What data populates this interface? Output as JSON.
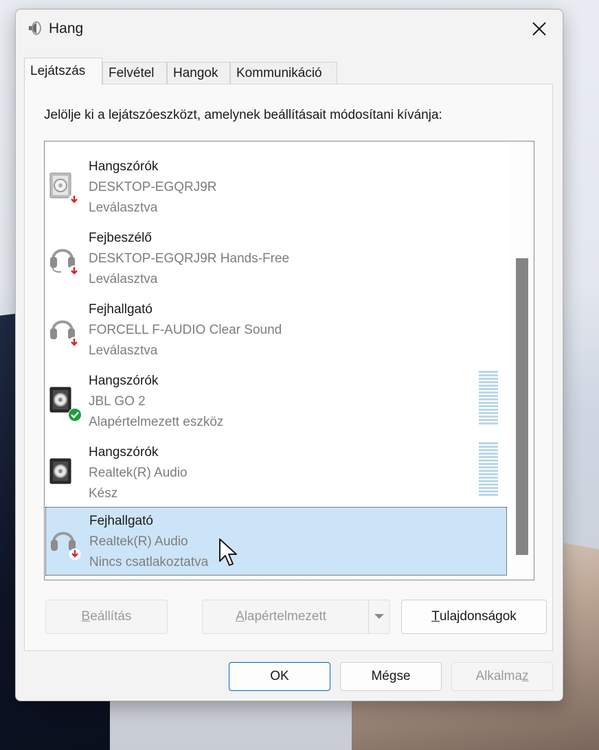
{
  "window": {
    "title": "Hang",
    "icon": "speaker-icon"
  },
  "tabs": [
    {
      "label": "Lejátszás",
      "active": true
    },
    {
      "label": "Felvétel",
      "active": false
    },
    {
      "label": "Hangok",
      "active": false
    },
    {
      "label": "Kommunikáció",
      "active": false
    }
  ],
  "instruction": "Jelölje ki a lejátszóeszközt, amelynek beállításait módosítani kívánja:",
  "devices": [
    {
      "name": "Hangszórók",
      "detail": "DESKTOP-EGQRJ9R",
      "status": "Leválasztva",
      "icon": "speaker-icon",
      "badge": "disconnected-arrow-icon"
    },
    {
      "name": "Fejbeszélő",
      "detail": "DESKTOP-EGQRJ9R Hands-Free",
      "status": "Leválasztva",
      "icon": "headset-icon",
      "badge": "disconnected-arrow-icon"
    },
    {
      "name": "Fejhallgató",
      "detail": "FORCELL F-AUDIO Clear Sound",
      "status": "Leválasztva",
      "icon": "headphones-icon",
      "badge": "disconnected-arrow-icon"
    },
    {
      "name": "Hangszórók",
      "detail": "JBL GO 2",
      "status": "Alapértelmezett eszköz",
      "icon": "speaker-icon",
      "badge": "default-check-icon"
    },
    {
      "name": "Hangszórók",
      "detail": "Realtek(R) Audio",
      "status": "Kész",
      "icon": "speaker-icon",
      "badge": ""
    },
    {
      "name": "Fejhallgató",
      "detail": "Realtek(R) Audio",
      "status": "Nincs csatlakoztatva",
      "icon": "headphones-icon",
      "badge": "disconnected-arrow-icon",
      "selected": true
    }
  ],
  "buttons": {
    "configure": {
      "label": "Beállítás",
      "accesskey": "B",
      "rest": "eállítás"
    },
    "set_default": {
      "label": "Alapértelmezett",
      "accesskey": "A",
      "rest": "lapértelmezett"
    },
    "properties": {
      "label": "Tulajdonságok",
      "accesskey": "T",
      "rest": "ulajdonságok"
    },
    "ok": "OK",
    "cancel": "Mégse",
    "apply": {
      "label": "Alkalmaz",
      "before": "Alkalma",
      "accesskey": "z"
    }
  },
  "colors": {
    "selection": "#cce4f7",
    "accent": "#0067c0",
    "disconnected_badge": "#d9262a",
    "default_badge": "#1f9d3a"
  }
}
